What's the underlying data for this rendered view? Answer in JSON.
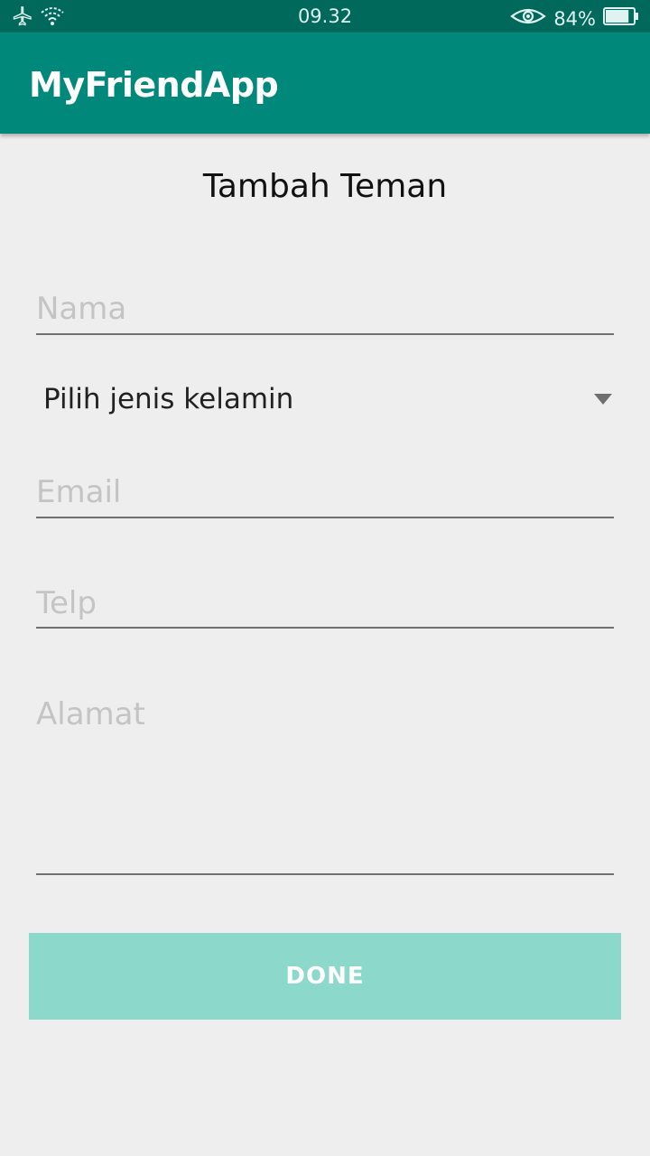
{
  "status_bar": {
    "time": "09.32",
    "battery_percent": "84%",
    "battery_level": 0.84,
    "icons": [
      "airplane-icon",
      "wifi-icon",
      "eye-icon",
      "battery-icon"
    ]
  },
  "app_bar": {
    "title": "MyFriendApp",
    "color": "#00897b"
  },
  "form": {
    "heading": "Tambah Teman",
    "nama_placeholder": "Nama",
    "gender_selected": "Pilih jenis kelamin",
    "email_placeholder": "Email",
    "telp_placeholder": "Telp",
    "alamat_placeholder": "Alamat",
    "done_label": "DONE"
  },
  "colors": {
    "status_bar": "#00695c",
    "primary": "#00897b",
    "button_disabled": "#8cd9cb"
  }
}
